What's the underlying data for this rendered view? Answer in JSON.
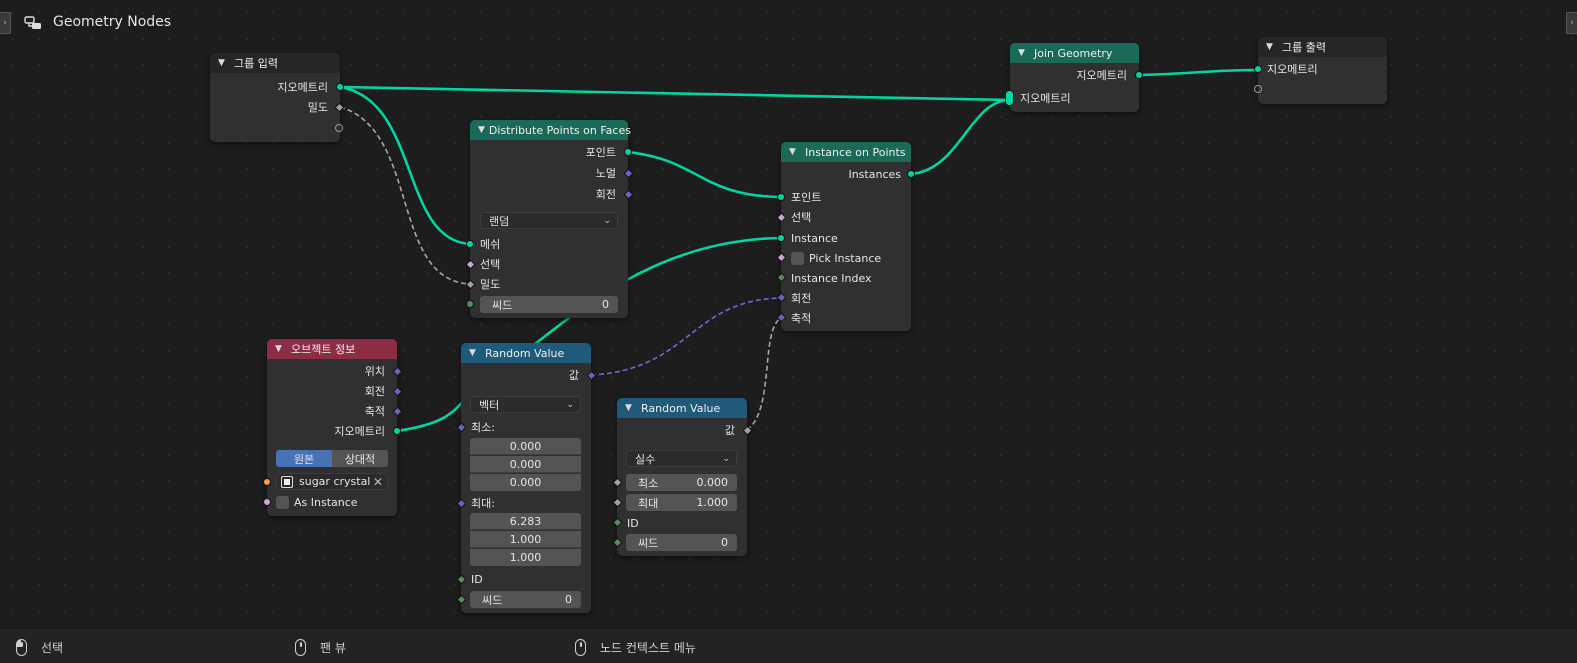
{
  "editor": {
    "title": "Geometry Nodes",
    "tree_icon": "node-tree-icon"
  },
  "colors": {
    "geometry": "#00d6a3",
    "vector": "#6363c7",
    "float": "#a1a1a1",
    "integer": "#598c5c",
    "boolean": "#cca6d6",
    "object": "#ed9e5c",
    "header_teal": "#1a6a5a",
    "header_pink": "#8c2c45",
    "header_blue": "#1f5a7a",
    "selected_blue": "#4772b3"
  },
  "group_input": {
    "title": "그룹 입력",
    "outputs": {
      "geometry": "지오메트리",
      "density": "밀도"
    }
  },
  "distribute": {
    "title": "Distribute Points on Faces",
    "outputs": {
      "points": "포인트",
      "normal": "노멀",
      "rotation": "회전"
    },
    "mode": "랜덤",
    "inputs": {
      "mesh": "메쉬",
      "selection": "선택",
      "density": "밀도"
    },
    "seed_label": "씨드",
    "seed_value": "0"
  },
  "object_info": {
    "title": "오브젝트 정보",
    "outputs": {
      "location": "위치",
      "rotation": "회전",
      "scale": "축적",
      "geometry": "지오메트리"
    },
    "modes": [
      "원본",
      "상대적"
    ],
    "object": "sugar crystal",
    "as_instance": "As Instance"
  },
  "random_vec": {
    "title": "Random Value",
    "output": "값",
    "type": "벡터",
    "min_label": "최소:",
    "min_values": [
      "0.000",
      "0.000",
      "0.000"
    ],
    "max_label": "최대:",
    "max_values": [
      "6.283",
      "1.000",
      "1.000"
    ],
    "id_label": "ID",
    "seed_label": "씨드",
    "seed_value": "0"
  },
  "random_flt": {
    "title": "Random Value",
    "output": "값",
    "type": "실수",
    "min_label": "최소",
    "min_value": "0.000",
    "max_label": "최대",
    "max_value": "1.000",
    "id_label": "ID",
    "seed_label": "씨드",
    "seed_value": "0"
  },
  "instance_on_points": {
    "title": "Instance on Points",
    "output": "Instances",
    "inputs": {
      "points": "포인트",
      "selection": "선택",
      "instance": "Instance",
      "pick_instance": "Pick Instance",
      "instance_index": "Instance Index",
      "rotation": "회전",
      "scale": "축적"
    }
  },
  "join_geometry": {
    "title": "Join Geometry",
    "output": "지오메트리",
    "input": "지오메트리"
  },
  "group_output": {
    "title": "그룹 출력",
    "input": "지오메트리"
  },
  "statusbar": {
    "select": "선택",
    "pan": "팬 뷰",
    "context": "노드 컨텍스트 메뉴"
  }
}
